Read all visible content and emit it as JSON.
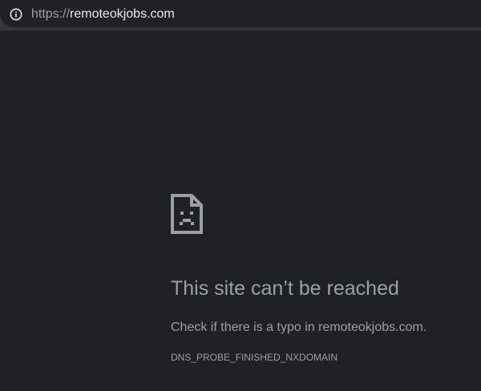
{
  "address_bar": {
    "scheme": "https://",
    "host": "remoteokjobs.com",
    "icon": "info-icon"
  },
  "error_page": {
    "icon": "sad-page-icon",
    "title": "This site can’t be reached",
    "message_prefix": "Check if there is a typo in ",
    "message_host": "remoteokjobs.com",
    "message_suffix": ".",
    "error_code": "DNS_PROBE_FINISHED_NXDOMAIN"
  },
  "colors": {
    "background": "#202124",
    "toolbar": "#35363a",
    "text": "#9aa0a6",
    "url_text": "#e8eaed"
  }
}
